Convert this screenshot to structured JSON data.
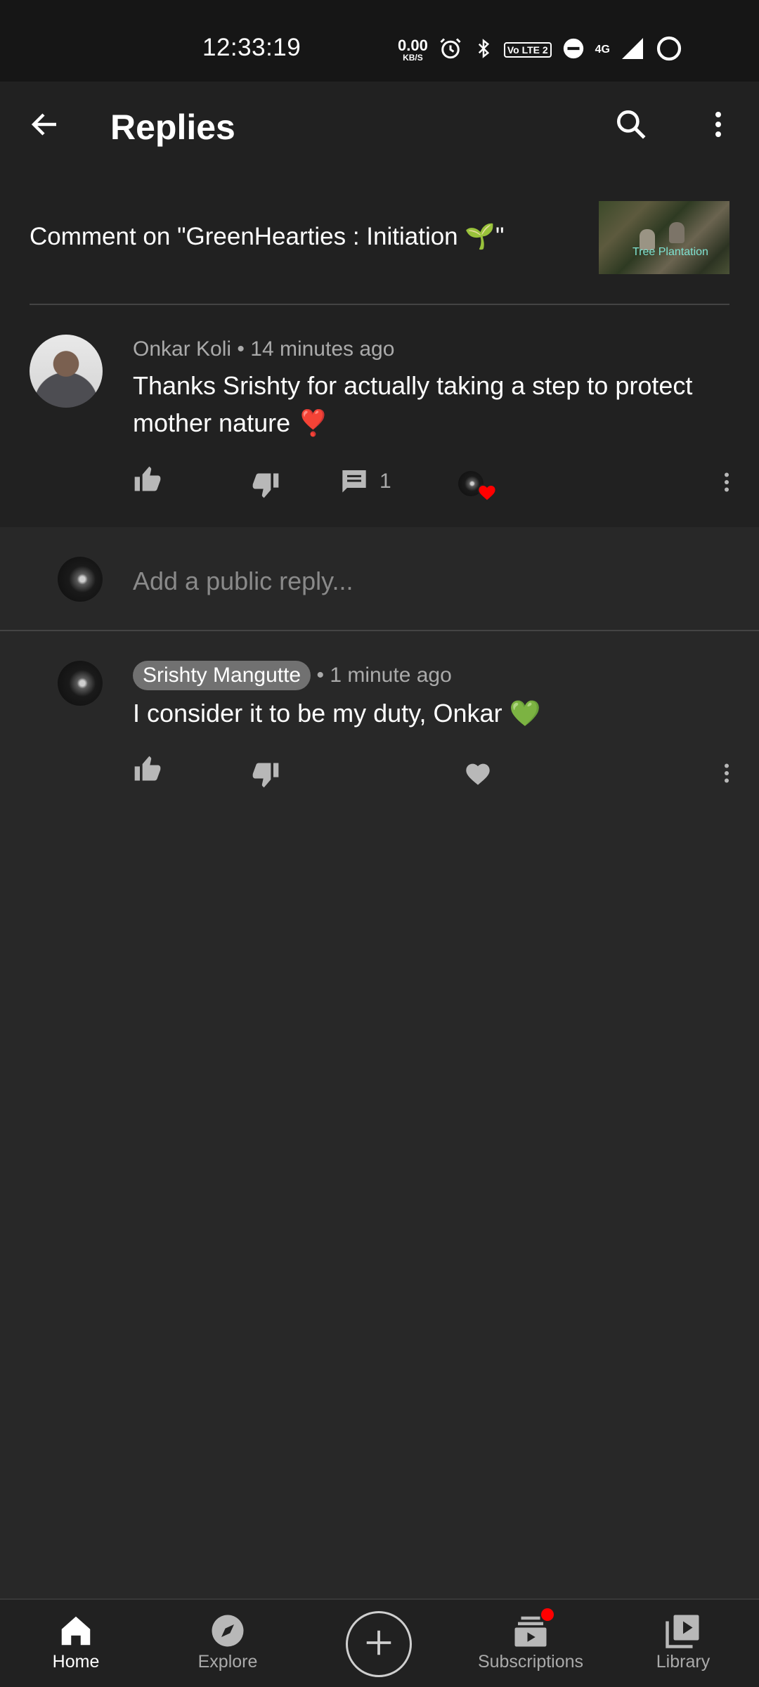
{
  "status_bar": {
    "time": "12:33:19",
    "net_speed_value": "0.00",
    "net_speed_unit": "KB/S",
    "volte_label": "Vo LTE 2",
    "network_type": "4G",
    "icons": [
      "alarm-icon",
      "bluetooth-icon",
      "dnd-icon",
      "signal-icon",
      "battery-ring-icon"
    ]
  },
  "app_bar": {
    "title": "Replies",
    "icons": [
      "back-arrow-icon",
      "search-icon",
      "more-vertical-icon"
    ]
  },
  "context": {
    "comment_on_label": "Comment on \"GreenHearties : Initiation 🌱\"",
    "thumbnail_text": "Tree Plantation"
  },
  "parent_comment": {
    "author": "Onkar Koli",
    "separator": "•",
    "timestamp": "14 minutes ago",
    "text": "Thanks Srishty for actually taking a step to protect mother nature",
    "emoji": "❣️",
    "reply_count": "1"
  },
  "reply_input": {
    "placeholder": "Add a public reply..."
  },
  "replies": [
    {
      "author": "Srishty Mangutte",
      "separator": "•",
      "timestamp": "1 minute ago",
      "text": "I consider it to be my duty, Onkar",
      "emoji": "💚"
    }
  ],
  "bottom_nav": {
    "items": [
      {
        "label": "Home",
        "icon": "home-icon",
        "active": true
      },
      {
        "label": "Explore",
        "icon": "compass-icon",
        "active": false
      },
      {
        "label": "",
        "icon": "create-plus-icon",
        "active": false
      },
      {
        "label": "Subscriptions",
        "icon": "subscriptions-icon",
        "active": false
      },
      {
        "label": "Library",
        "icon": "library-icon",
        "active": false
      }
    ]
  },
  "colors": {
    "background": "#282828",
    "surface": "#212121",
    "status_bar": "#161616",
    "muted_text": "#aaaaaa",
    "heart_red": "#e53935",
    "badge_red": "#ff0000"
  }
}
